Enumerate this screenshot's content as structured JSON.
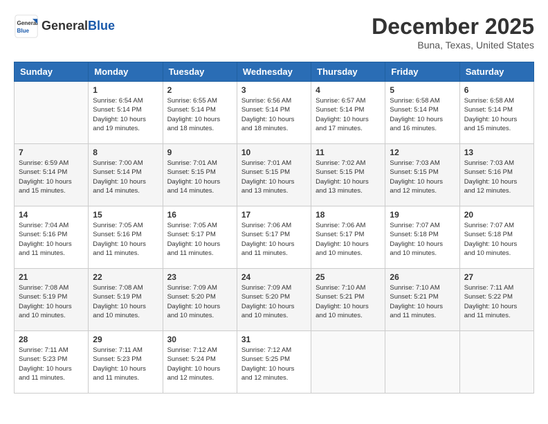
{
  "header": {
    "logo": {
      "general": "General",
      "blue": "Blue"
    },
    "title": "December 2025",
    "location": "Buna, Texas, United States"
  },
  "weekdays": [
    "Sunday",
    "Monday",
    "Tuesday",
    "Wednesday",
    "Thursday",
    "Friday",
    "Saturday"
  ],
  "weeks": [
    [
      {
        "day": "",
        "empty": true
      },
      {
        "day": "1",
        "sunrise": "Sunrise: 6:54 AM",
        "sunset": "Sunset: 5:14 PM",
        "daylight": "Daylight: 10 hours and 19 minutes."
      },
      {
        "day": "2",
        "sunrise": "Sunrise: 6:55 AM",
        "sunset": "Sunset: 5:14 PM",
        "daylight": "Daylight: 10 hours and 18 minutes."
      },
      {
        "day": "3",
        "sunrise": "Sunrise: 6:56 AM",
        "sunset": "Sunset: 5:14 PM",
        "daylight": "Daylight: 10 hours and 18 minutes."
      },
      {
        "day": "4",
        "sunrise": "Sunrise: 6:57 AM",
        "sunset": "Sunset: 5:14 PM",
        "daylight": "Daylight: 10 hours and 17 minutes."
      },
      {
        "day": "5",
        "sunrise": "Sunrise: 6:58 AM",
        "sunset": "Sunset: 5:14 PM",
        "daylight": "Daylight: 10 hours and 16 minutes."
      },
      {
        "day": "6",
        "sunrise": "Sunrise: 6:58 AM",
        "sunset": "Sunset: 5:14 PM",
        "daylight": "Daylight: 10 hours and 15 minutes."
      }
    ],
    [
      {
        "day": "7",
        "sunrise": "Sunrise: 6:59 AM",
        "sunset": "Sunset: 5:14 PM",
        "daylight": "Daylight: 10 hours and 15 minutes."
      },
      {
        "day": "8",
        "sunrise": "Sunrise: 7:00 AM",
        "sunset": "Sunset: 5:14 PM",
        "daylight": "Daylight: 10 hours and 14 minutes."
      },
      {
        "day": "9",
        "sunrise": "Sunrise: 7:01 AM",
        "sunset": "Sunset: 5:15 PM",
        "daylight": "Daylight: 10 hours and 14 minutes."
      },
      {
        "day": "10",
        "sunrise": "Sunrise: 7:01 AM",
        "sunset": "Sunset: 5:15 PM",
        "daylight": "Daylight: 10 hours and 13 minutes."
      },
      {
        "day": "11",
        "sunrise": "Sunrise: 7:02 AM",
        "sunset": "Sunset: 5:15 PM",
        "daylight": "Daylight: 10 hours and 13 minutes."
      },
      {
        "day": "12",
        "sunrise": "Sunrise: 7:03 AM",
        "sunset": "Sunset: 5:15 PM",
        "daylight": "Daylight: 10 hours and 12 minutes."
      },
      {
        "day": "13",
        "sunrise": "Sunrise: 7:03 AM",
        "sunset": "Sunset: 5:16 PM",
        "daylight": "Daylight: 10 hours and 12 minutes."
      }
    ],
    [
      {
        "day": "14",
        "sunrise": "Sunrise: 7:04 AM",
        "sunset": "Sunset: 5:16 PM",
        "daylight": "Daylight: 10 hours and 11 minutes."
      },
      {
        "day": "15",
        "sunrise": "Sunrise: 7:05 AM",
        "sunset": "Sunset: 5:16 PM",
        "daylight": "Daylight: 10 hours and 11 minutes."
      },
      {
        "day": "16",
        "sunrise": "Sunrise: 7:05 AM",
        "sunset": "Sunset: 5:17 PM",
        "daylight": "Daylight: 10 hours and 11 minutes."
      },
      {
        "day": "17",
        "sunrise": "Sunrise: 7:06 AM",
        "sunset": "Sunset: 5:17 PM",
        "daylight": "Daylight: 10 hours and 11 minutes."
      },
      {
        "day": "18",
        "sunrise": "Sunrise: 7:06 AM",
        "sunset": "Sunset: 5:17 PM",
        "daylight": "Daylight: 10 hours and 10 minutes."
      },
      {
        "day": "19",
        "sunrise": "Sunrise: 7:07 AM",
        "sunset": "Sunset: 5:18 PM",
        "daylight": "Daylight: 10 hours and 10 minutes."
      },
      {
        "day": "20",
        "sunrise": "Sunrise: 7:07 AM",
        "sunset": "Sunset: 5:18 PM",
        "daylight": "Daylight: 10 hours and 10 minutes."
      }
    ],
    [
      {
        "day": "21",
        "sunrise": "Sunrise: 7:08 AM",
        "sunset": "Sunset: 5:19 PM",
        "daylight": "Daylight: 10 hours and 10 minutes."
      },
      {
        "day": "22",
        "sunrise": "Sunrise: 7:08 AM",
        "sunset": "Sunset: 5:19 PM",
        "daylight": "Daylight: 10 hours and 10 minutes."
      },
      {
        "day": "23",
        "sunrise": "Sunrise: 7:09 AM",
        "sunset": "Sunset: 5:20 PM",
        "daylight": "Daylight: 10 hours and 10 minutes."
      },
      {
        "day": "24",
        "sunrise": "Sunrise: 7:09 AM",
        "sunset": "Sunset: 5:20 PM",
        "daylight": "Daylight: 10 hours and 10 minutes."
      },
      {
        "day": "25",
        "sunrise": "Sunrise: 7:10 AM",
        "sunset": "Sunset: 5:21 PM",
        "daylight": "Daylight: 10 hours and 10 minutes."
      },
      {
        "day": "26",
        "sunrise": "Sunrise: 7:10 AM",
        "sunset": "Sunset: 5:21 PM",
        "daylight": "Daylight: 10 hours and 11 minutes."
      },
      {
        "day": "27",
        "sunrise": "Sunrise: 7:11 AM",
        "sunset": "Sunset: 5:22 PM",
        "daylight": "Daylight: 10 hours and 11 minutes."
      }
    ],
    [
      {
        "day": "28",
        "sunrise": "Sunrise: 7:11 AM",
        "sunset": "Sunset: 5:23 PM",
        "daylight": "Daylight: 10 hours and 11 minutes."
      },
      {
        "day": "29",
        "sunrise": "Sunrise: 7:11 AM",
        "sunset": "Sunset: 5:23 PM",
        "daylight": "Daylight: 10 hours and 11 minutes."
      },
      {
        "day": "30",
        "sunrise": "Sunrise: 7:12 AM",
        "sunset": "Sunset: 5:24 PM",
        "daylight": "Daylight: 10 hours and 12 minutes."
      },
      {
        "day": "31",
        "sunrise": "Sunrise: 7:12 AM",
        "sunset": "Sunset: 5:25 PM",
        "daylight": "Daylight: 10 hours and 12 minutes."
      },
      {
        "day": "",
        "empty": true
      },
      {
        "day": "",
        "empty": true
      },
      {
        "day": "",
        "empty": true
      }
    ]
  ]
}
